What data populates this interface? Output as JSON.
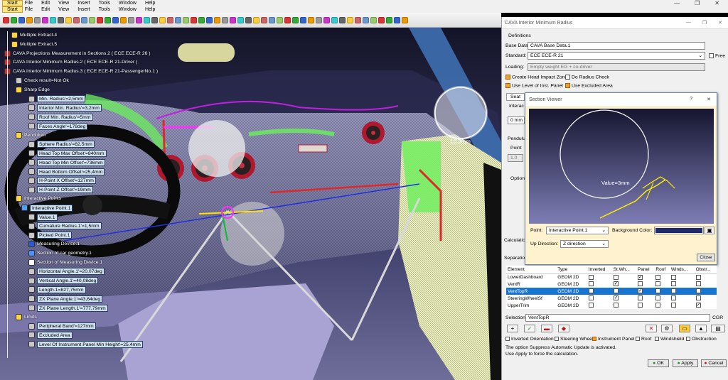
{
  "menu_top": {
    "start": "Start",
    "items": [
      "File",
      "Edit",
      "View",
      "Insert",
      "Tools",
      "Window",
      "Help"
    ]
  },
  "menu_second": {
    "start": "Start",
    "items": [
      "File",
      "Edit",
      "View",
      "Insert",
      "Tools",
      "Window",
      "Help"
    ]
  },
  "tree": [
    {
      "label": "Multiple Extract.4",
      "boxed": false,
      "color": "#ffd640"
    },
    {
      "label": "Multiple Extract.5",
      "boxed": false,
      "color": "#ffd640"
    },
    {
      "label": "CAVA Projections Measurement in Sections.2 ( ECE ECE-R 26 )",
      "boxed": false,
      "color": "#d23030"
    },
    {
      "label": "CAVA Interior Minimum Radius.2 ( ECE ECE-R 21-Driver )",
      "boxed": false,
      "color": "#d23030"
    },
    {
      "label": "CAVA Interior Minimum Radius.3 ( ECE ECE-R 21-PassengerNo.1 )",
      "boxed": false,
      "color": "#d23030"
    },
    {
      "label": "Check result=Not Ok",
      "boxed": false,
      "color": "#c8c8c8"
    },
    {
      "label": "Sharp Edge",
      "boxed": false,
      "color": "#ffd640"
    },
    {
      "label": "Min. Radius'=2,5mm",
      "boxed": true,
      "color": "#c8c8c8"
    },
    {
      "label": "Interior Min. Radius'=3,2mm",
      "boxed": true,
      "color": "#c8c8c8"
    },
    {
      "label": "Roof Min. Radius'=5mm",
      "boxed": true,
      "color": "#c8c8c8"
    },
    {
      "label": "Faces Angle'=178deg",
      "boxed": true,
      "color": "#c8c8c8"
    },
    {
      "label": "Pendulum",
      "boxed": false,
      "color": "#ffd640"
    },
    {
      "label": "Sphere Radius'=82,5mm",
      "boxed": true,
      "color": "#c8c8c8"
    },
    {
      "label": "Head Top Max Offset'=840mm",
      "boxed": true,
      "color": "#c8c8c8"
    },
    {
      "label": "Head Top Min Offset'=736mm",
      "boxed": true,
      "color": "#c8c8c8"
    },
    {
      "label": "Head Bottom Offset'=25,4mm",
      "boxed": true,
      "color": "#c8c8c8"
    },
    {
      "label": "H-Point X Offset'=127mm",
      "boxed": true,
      "color": "#c8c8c8"
    },
    {
      "label": "H-Point Z Offset'=19mm",
      "boxed": true,
      "color": "#c8c8c8"
    },
    {
      "label": "Interactive Points",
      "boxed": false,
      "color": "#ffd640"
    },
    {
      "label": "Interactive Point.1",
      "boxed": true,
      "color": "#4aa0ff"
    },
    {
      "label": "Value.1",
      "boxed": true,
      "color": "#c8c8c8"
    },
    {
      "label": "Curvature Radius.1'=1,5mm",
      "boxed": true,
      "color": "#c8c8c8"
    },
    {
      "label": "Picked Point.1",
      "boxed": true,
      "color": "#c8c8c8"
    },
    {
      "label": "Measuring Device.1",
      "boxed": false,
      "color": "#2a5bd7"
    },
    {
      "label": "Section of car geometry.1",
      "boxed": false,
      "color": "#4a90ff"
    },
    {
      "label": "Section of Measuring Device.1",
      "boxed": false,
      "color": "#ffffff"
    },
    {
      "label": "Horizontal Angle.1'=20,07deg",
      "boxed": true,
      "color": "#c8c8c8"
    },
    {
      "label": "Vertical Angle.1'=40,08deg",
      "boxed": true,
      "color": "#c8c8c8"
    },
    {
      "label": "Length.1=827,75mm",
      "boxed": true,
      "color": "#c8c8c8"
    },
    {
      "label": "ZX Plane Angle.1'=43,64deg",
      "boxed": true,
      "color": "#c8c8c8"
    },
    {
      "label": "ZX Plane Length.1'=777,79mm",
      "boxed": true,
      "color": "#c8c8c8"
    },
    {
      "label": "Limits",
      "boxed": false,
      "color": "#ffd640"
    },
    {
      "label": "Peripheral Band'=127mm",
      "boxed": true,
      "color": "#c8c8c8"
    },
    {
      "label": "Excluded Area",
      "boxed": true,
      "color": "#c8c8c8"
    },
    {
      "label": "Level Of Instrument Panel Min Height'=25,4mm",
      "boxed": true,
      "color": "#c8c8c8"
    }
  ],
  "viewport": {
    "sphere_value": "10.3mm"
  },
  "dialog": {
    "title": "CAVA Interior Minimum Radius",
    "definitions_label": "Definitions",
    "base_data_label": "Base Data:",
    "base_data_value": "CAVA Base Data.1",
    "standard_label": "Standard:",
    "standard_value": "ECE ECE-R 21",
    "free_label": "Free",
    "loading_label": "Loading:",
    "loading_value": "Empty weight EG + co-driver",
    "create_head_impact": "Create Head Impact Zone",
    "do_radius_check": "Do Radius Check",
    "use_level": "Use Level of Inst. Panel",
    "use_excluded": "Use Excluded Area",
    "tab_seat": "Seat",
    "interaction_label": "Interac",
    "zero_value": "0 mm",
    "pendulum_label": "Pendulu",
    "point_label": "Point",
    "one_value": "1.0",
    "options_label": "Options",
    "calculation_label": "Calculation",
    "separation_label": "Separation",
    "table_headers": [
      "Element",
      "Type",
      "Inverted",
      "St.Wh...",
      "Panel",
      "Roof",
      "Winds...",
      "Obstr..."
    ],
    "rows": [
      {
        "element": "LowerDashboard",
        "type": "GEOM 2D",
        "checks": [
          false,
          false,
          true,
          false,
          false,
          false
        ],
        "selected": false
      },
      {
        "element": "VentR",
        "type": "GEOM 2D",
        "checks": [
          false,
          true,
          false,
          false,
          false,
          false
        ],
        "selected": false
      },
      {
        "element": "VentTopR",
        "type": "GEOM 2D",
        "checks": [
          false,
          false,
          true,
          false,
          false,
          false
        ],
        "selected": true
      },
      {
        "element": "SteeringWheelSf",
        "type": "GEOM 2D",
        "checks": [
          false,
          true,
          false,
          false,
          false,
          false
        ],
        "selected": false
      },
      {
        "element": "UpperTrim",
        "type": "GEOM 2D",
        "checks": [
          false,
          false,
          false,
          false,
          false,
          true
        ],
        "selected": false
      }
    ],
    "selection_label": "Selection:",
    "selection_value": "VentTopR",
    "cgr_label": "CGR",
    "legend_inverted": "Inverted Orientation",
    "legend_steering": "Steering Wheel",
    "legend_panel": "Instrument Panel",
    "legend_roof": "Roof",
    "legend_windshield": "Windshield",
    "legend_obstruction": "Obstruction",
    "note1": "The option Suppress Automatic Update is activated.",
    "note2": "Use Apply to force the calculation.",
    "ok": "OK",
    "apply": "Apply",
    "cancel": "Cancel"
  },
  "section_viewer": {
    "title": "Section Viewer",
    "help": "?",
    "close_x": "✕",
    "value_text": "Value=3mm",
    "point_label": "Point:",
    "point_value": "Interactive Point.1",
    "bg_label": "Background Color:",
    "bg_color": "#1f2a6a",
    "up_label": "Up Direction:",
    "up_value": "Z direction",
    "close": "Close"
  }
}
